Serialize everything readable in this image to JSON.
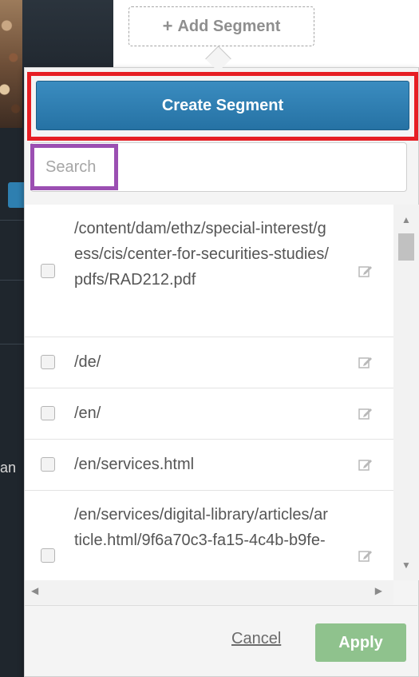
{
  "toolbar": {
    "add_segment_label": "Add Segment",
    "add_icon": "plus-icon"
  },
  "panel": {
    "create_segment_label": "Create Segment",
    "search_placeholder": "Search",
    "cancel_label": "Cancel",
    "apply_label": "Apply"
  },
  "segments": [
    {
      "label": "/content/dam/ethz/special-interest/gess/cis/center-for-securities-studies/pdfs/RAD212.pdf",
      "checked": false,
      "icon": "edit-icon"
    },
    {
      "label": "/de/",
      "checked": false,
      "icon": "edit-icon"
    },
    {
      "label": "/en/",
      "checked": false,
      "icon": "edit-icon"
    },
    {
      "label": "/en/services.html",
      "checked": false,
      "icon": "edit-icon"
    },
    {
      "label": "/en/services/digital-library/articles/article.html/9f6a70c3-fa15-4c4b-b9fe-",
      "checked": false,
      "icon": "edit-icon"
    }
  ],
  "background": {
    "partial_text": "an"
  },
  "colors": {
    "create_button": "#2e7fb0",
    "apply_button": "#8fc28d",
    "highlight_red": "#e61e24",
    "highlight_purple": "#9b4fb2"
  }
}
